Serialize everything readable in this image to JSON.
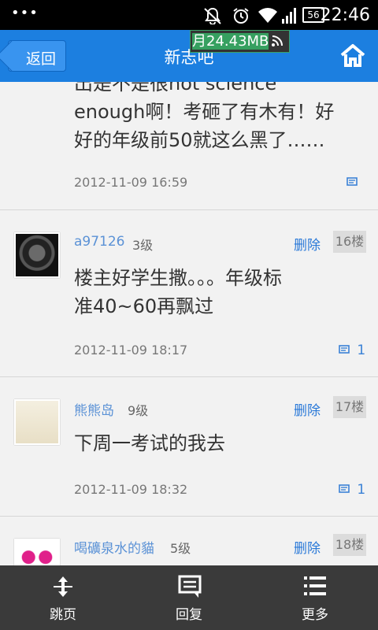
{
  "status_bar": {
    "time": "22:46",
    "signal_badge": "56",
    "icons": [
      "notifications-off-icon",
      "alarm-icon",
      "wifi-icon",
      "signal-icon",
      "battery-icon"
    ]
  },
  "header": {
    "back_label": "返回",
    "title": "新志吧",
    "home_icon": "home-icon",
    "accent_color": "#1c7fe0"
  },
  "traffic_overlay": {
    "prefix": "月",
    "value": "24.43MB"
  },
  "posts": [
    {
      "content": "出是不是很not science enough啊！考砸了有木有！好好的年级前50就这么黑了……",
      "content_line1": "出是不是很not science",
      "content_line2": "enough啊！考砸了有木有！好",
      "content_line3": "好的年级前50就这么黑了……",
      "timestamp": "2012-11-09 16:59",
      "reply_count": ""
    },
    {
      "username": "a97126",
      "level": "3级",
      "delete_label": "删除",
      "floor": "16楼",
      "content_line1": "楼主好学生撒。。。年级标",
      "content_line2": "准40~60再飘过",
      "timestamp": "2012-11-09 18:17",
      "reply_count": "1"
    },
    {
      "username": "熊熊岛",
      "level": "9级",
      "delete_label": "删除",
      "floor": "17楼",
      "content_line1": "下周一考试的我去",
      "timestamp": "2012-11-09 18:32",
      "reply_count": "1"
    },
    {
      "username": "喝礦泉水的貓",
      "level": "5级",
      "delete_label": "删除",
      "floor": "18楼"
    }
  ],
  "bottom_bar": {
    "jump_label": "跳页",
    "reply_label": "回复",
    "more_label": "更多"
  }
}
